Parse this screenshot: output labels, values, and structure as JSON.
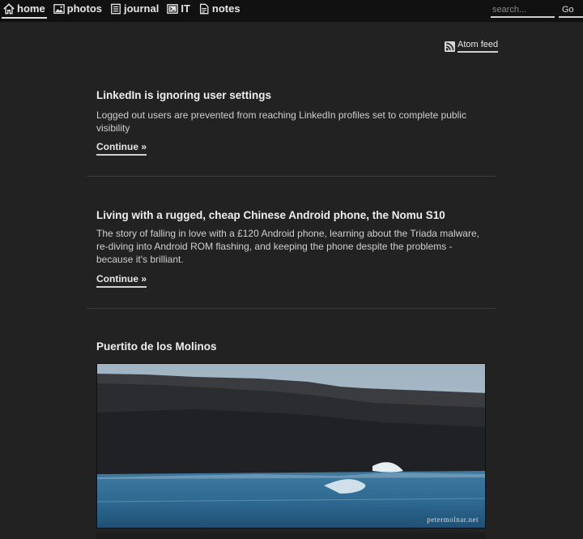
{
  "nav": {
    "items": [
      {
        "label": "home",
        "icon": "home-icon",
        "active": true
      },
      {
        "label": "photos",
        "icon": "image-icon"
      },
      {
        "label": "journal",
        "icon": "journal-icon"
      },
      {
        "label": "IT",
        "icon": "terminal-icon"
      },
      {
        "label": "notes",
        "icon": "note-icon"
      }
    ],
    "search_placeholder": "search...",
    "go_label": "Go"
  },
  "feed": {
    "label": "Atom feed",
    "icon": "rss-icon"
  },
  "articles": [
    {
      "title": "LinkedIn is ignoring user settings",
      "summary": "Logged out users are prevented from reaching LinkedIn profiles set to complete public visibility",
      "continue_label": "Continue »"
    },
    {
      "title": "Living with a rugged, cheap Chinese Android phone, the Nomu S10",
      "summary": "The story of falling in love with a £120 Android phone, learning about the Triada malware, re-diving into Android ROM flashing, and keeping the phone despite the problems - because it's brilliant.",
      "continue_label": "Continue »"
    },
    {
      "title": "Puertito de los Molinos",
      "photo_watermark": "petermolnar.net"
    }
  ],
  "colors": {
    "background": "#222222",
    "topbar": "#111111",
    "text": "#cfcfcf",
    "heading": "#eeeeee"
  }
}
